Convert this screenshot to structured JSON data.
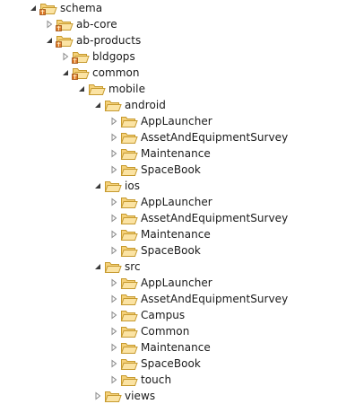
{
  "tree": {
    "nodes": [
      {
        "label": "schema",
        "depth": 0,
        "state": "expanded",
        "icon": "package-folder-icon"
      },
      {
        "label": "ab-core",
        "depth": 1,
        "state": "collapsed",
        "icon": "package-folder-icon"
      },
      {
        "label": "ab-products",
        "depth": 1,
        "state": "expanded",
        "icon": "package-folder-icon"
      },
      {
        "label": "bldgops",
        "depth": 2,
        "state": "collapsed",
        "icon": "package-folder-icon"
      },
      {
        "label": "common",
        "depth": 2,
        "state": "expanded",
        "icon": "package-folder-icon"
      },
      {
        "label": "mobile",
        "depth": 3,
        "state": "expanded",
        "icon": "folder-icon"
      },
      {
        "label": "android",
        "depth": 4,
        "state": "expanded",
        "icon": "folder-icon"
      },
      {
        "label": "AppLauncher",
        "depth": 5,
        "state": "collapsed",
        "icon": "folder-icon"
      },
      {
        "label": "AssetAndEquipmentSurvey",
        "depth": 5,
        "state": "collapsed",
        "icon": "folder-icon"
      },
      {
        "label": "Maintenance",
        "depth": 5,
        "state": "collapsed",
        "icon": "folder-icon"
      },
      {
        "label": "SpaceBook",
        "depth": 5,
        "state": "collapsed",
        "icon": "folder-icon"
      },
      {
        "label": "ios",
        "depth": 4,
        "state": "expanded",
        "icon": "folder-icon"
      },
      {
        "label": "AppLauncher",
        "depth": 5,
        "state": "collapsed",
        "icon": "folder-icon"
      },
      {
        "label": "AssetAndEquipmentSurvey",
        "depth": 5,
        "state": "collapsed",
        "icon": "folder-icon"
      },
      {
        "label": "Maintenance",
        "depth": 5,
        "state": "collapsed",
        "icon": "folder-icon"
      },
      {
        "label": "SpaceBook",
        "depth": 5,
        "state": "collapsed",
        "icon": "folder-icon"
      },
      {
        "label": "src",
        "depth": 4,
        "state": "expanded",
        "icon": "folder-icon"
      },
      {
        "label": "AppLauncher",
        "depth": 5,
        "state": "collapsed",
        "icon": "folder-icon"
      },
      {
        "label": "AssetAndEquipmentSurvey",
        "depth": 5,
        "state": "collapsed",
        "icon": "folder-icon"
      },
      {
        "label": "Campus",
        "depth": 5,
        "state": "collapsed",
        "icon": "folder-icon"
      },
      {
        "label": "Common",
        "depth": 5,
        "state": "collapsed",
        "icon": "folder-icon"
      },
      {
        "label": "Maintenance",
        "depth": 5,
        "state": "collapsed",
        "icon": "folder-icon"
      },
      {
        "label": "SpaceBook",
        "depth": 5,
        "state": "collapsed",
        "icon": "folder-icon"
      },
      {
        "label": "touch",
        "depth": 5,
        "state": "collapsed",
        "icon": "folder-icon"
      },
      {
        "label": "views",
        "depth": 4,
        "state": "collapsed",
        "icon": "folder-icon"
      }
    ]
  },
  "colors": {
    "folder_fill": "#f5d17a",
    "folder_stroke": "#c69a2f",
    "package_badge": "#e07b2a",
    "text": "#1a1a1a"
  }
}
